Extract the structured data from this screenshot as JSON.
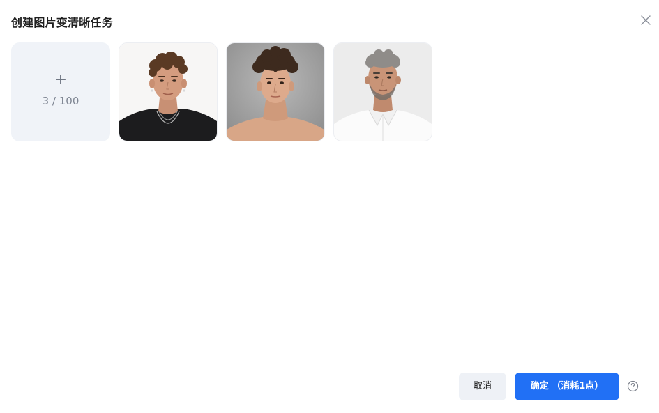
{
  "dialog": {
    "title": "创建图片变清晰任务",
    "close_icon": "close-icon"
  },
  "upload": {
    "plus_symbol": "+",
    "count_text": "3 / 100"
  },
  "images": [
    {
      "name": "portrait-curly-hair-black-tshirt",
      "background": "#f7f7f7"
    },
    {
      "name": "portrait-wavy-hair-shirtless",
      "background": "#a9a9a9"
    },
    {
      "name": "portrait-gray-hair-white-shirt",
      "background": "#ececec"
    }
  ],
  "footer": {
    "cancel_label": "取消",
    "confirm_label": "确定 （消耗1点）",
    "help_icon": "question-circle-icon"
  },
  "colors": {
    "primary": "#2170f5",
    "tile_bg": "#f0f3f8",
    "cancel_bg": "#eef1f6"
  }
}
